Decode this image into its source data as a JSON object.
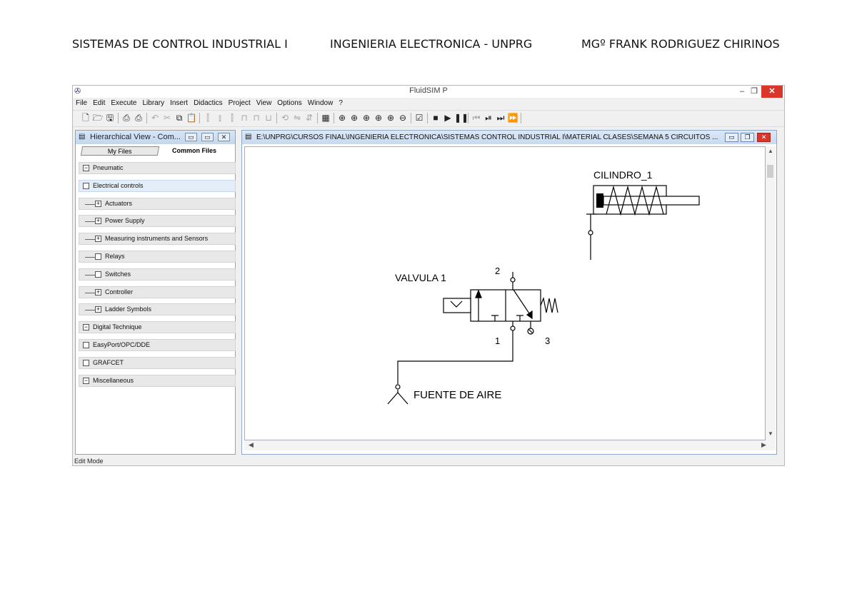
{
  "document_header": {
    "left": "SISTEMAS DE CONTROL INDUSTRIAL I",
    "center": "INGENIERIA ELECTRONICA - UNPRG",
    "right": "MGº FRANK RODRIGUEZ CHIRINOS"
  },
  "window": {
    "title": "FluidSIM P",
    "minimize": "–",
    "restore": "❐",
    "close": "✕"
  },
  "menu": [
    "File",
    "Edit",
    "Execute",
    "Library",
    "Insert",
    "Didactics",
    "Project",
    "View",
    "Options",
    "Window",
    "?"
  ],
  "left_panel": {
    "title": "Hierarchical View - Com...",
    "tabs": [
      "My Files",
      "Common Files"
    ],
    "tree": [
      {
        "label": "Pneumatic",
        "toggle": "−",
        "level": 0
      },
      {
        "label": "Electrical controls",
        "toggle": "",
        "level": 0,
        "selected": true
      },
      {
        "label": "Actuators",
        "toggle": "+",
        "level": 1
      },
      {
        "label": "Power Supply",
        "toggle": "+",
        "level": 1
      },
      {
        "label": "Measuring instruments and Sensors",
        "toggle": "+",
        "level": 1
      },
      {
        "label": "Relays",
        "toggle": "",
        "level": 1
      },
      {
        "label": "Switches",
        "toggle": "",
        "level": 1
      },
      {
        "label": "Controller",
        "toggle": "+",
        "level": 1
      },
      {
        "label": "Ladder Symbols",
        "toggle": "+",
        "level": 1
      },
      {
        "label": "Digital Technique",
        "toggle": "−",
        "level": 0
      },
      {
        "label": "EasyPort/OPC/DDE",
        "toggle": "",
        "level": 0
      },
      {
        "label": "GRAFCET",
        "toggle": "",
        "level": 0
      },
      {
        "label": "Miscellaneous",
        "toggle": "−",
        "level": 0
      }
    ]
  },
  "document_window": {
    "title": "E:\\UNPRG\\CURSOS FINAL\\INGENIERIA ELECTRONICA\\SISTEMAS CONTROL INDUSTRIAL I\\MATERIAL CLASES\\SEMANA 5 CIRCUITOS ..."
  },
  "circuit": {
    "cylinder_label": "CILINDRO_1",
    "valve_label": "VALVULA 1",
    "port_2": "2",
    "port_1": "1",
    "port_3": "3",
    "supply_label": "FUENTE DE AIRE"
  },
  "status": {
    "mode": "Edit Mode"
  }
}
